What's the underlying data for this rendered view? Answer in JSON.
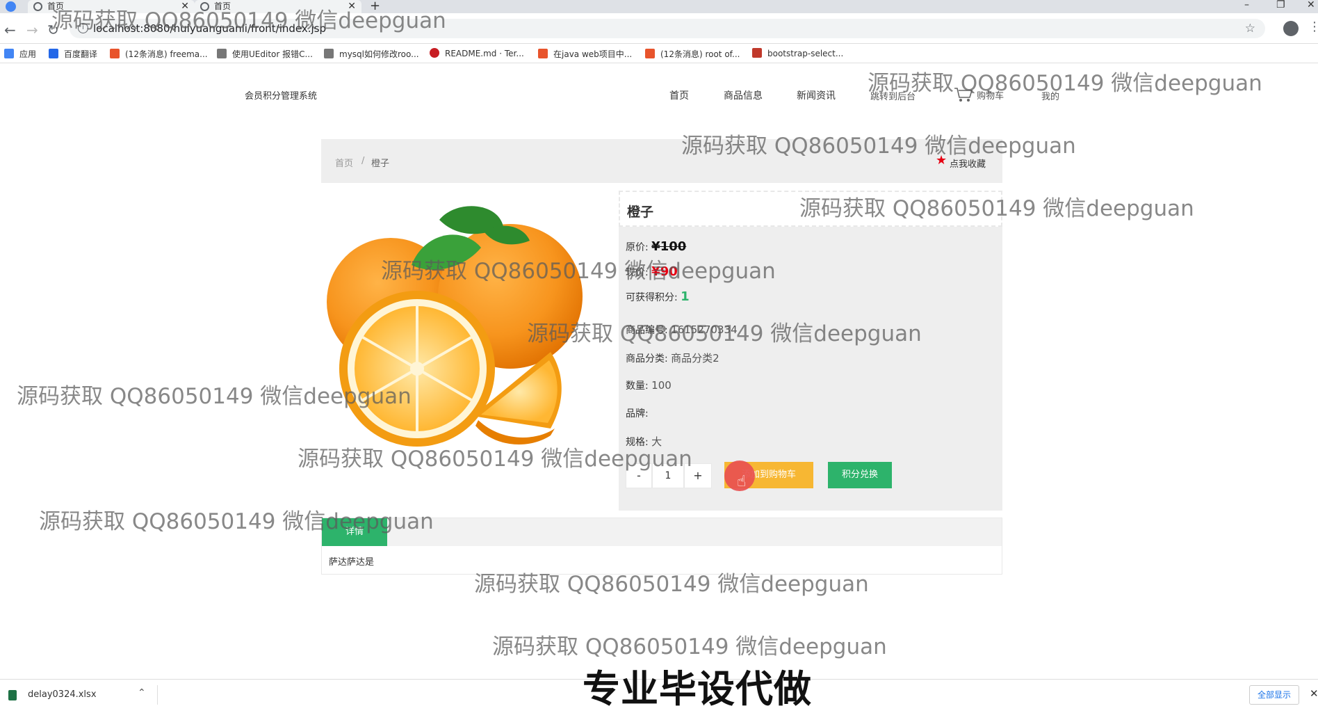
{
  "browser": {
    "tabs": [
      {
        "title": "首页"
      },
      {
        "title": "首页"
      }
    ],
    "address": "localhost:8080/huiyuanguanli/front/index.jsp",
    "bookmarks": [
      {
        "label": "应用",
        "color": "#4285f4"
      },
      {
        "label": "百度翻译",
        "color": "#2468e8"
      },
      {
        "label": "(12条消息) freema...",
        "color": "#e8542c"
      },
      {
        "label": "使用UEditor 报错C...",
        "color": "#555555"
      },
      {
        "label": "mysql如何修改roo...",
        "color": "#555555"
      },
      {
        "label": "README.md · Ter...",
        "color": "#c71d23"
      },
      {
        "label": "在java web项目中...",
        "color": "#e8542c"
      },
      {
        "label": "(12条消息) root of...",
        "color": "#e8542c"
      },
      {
        "label": "bootstrap-select...",
        "color": "#c0392b"
      }
    ]
  },
  "site": {
    "title": "会员积分管理系统",
    "nav": {
      "home": "首页",
      "products": "商品信息",
      "news": "新闻资讯",
      "admin": "跳转到后台",
      "cart": "购物车",
      "mine": "我的"
    }
  },
  "breadcrumb": {
    "home": "首页",
    "sep": "/",
    "current": "橙子",
    "favorite": "点我收藏"
  },
  "product": {
    "name": "橙子",
    "original_price_label": "原价:",
    "original_price": "¥100",
    "current_price_label": "现价:",
    "current_price": "¥90",
    "points_label": "可获得积分:",
    "points": "1",
    "code_label": "商品编号:",
    "code": "1615270334",
    "category_label": "商品分类:",
    "category": "商品分类2",
    "quantity_label": "数量:",
    "quantity": "100",
    "brand_label": "品牌:",
    "brand": "",
    "spec_label": "规格:",
    "spec": "大",
    "qty_minus": "-",
    "qty_value": "1",
    "qty_plus": "+",
    "add_to_cart": "添加到购物车",
    "points_exchange": "积分兑换"
  },
  "details": {
    "tab": "详情",
    "content": "萨达萨达是"
  },
  "downloads": {
    "file": "delay0324.xlsx",
    "show_all": "全部显示"
  },
  "overlay": {
    "watermark": "源码获取 QQ86050149 微信deepguan",
    "banner": "专业毕设代做"
  }
}
